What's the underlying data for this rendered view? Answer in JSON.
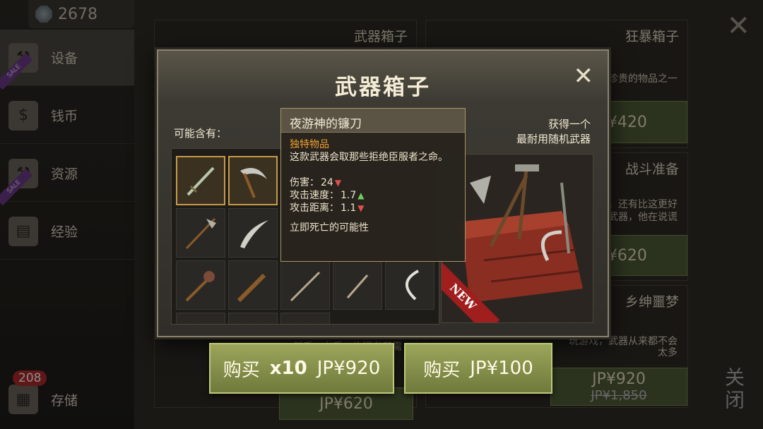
{
  "header": {
    "gem_count": "2678"
  },
  "sidebar": {
    "items": [
      {
        "label": "设备",
        "sale": "SALE"
      },
      {
        "label": "钱币"
      },
      {
        "label": "资源",
        "sale": "SALE"
      },
      {
        "label": "经验"
      }
    ],
    "storage": {
      "label": "存储",
      "badge": "208"
    }
  },
  "background_cards": {
    "weapon_box_title": "武器箱子",
    "rage_box_title": "狂暴箱子",
    "rage_box_desc": "珍贵的物品之一",
    "rage_box_price": "JP¥420",
    "battle_prep_title": "战斗准备",
    "battle_prep_desc1": "，还有比这更好",
    "battle_prep_desc2": "武器，他在说谎",
    "battle_prep_price": "JP¥620",
    "squire_title": "乡绅噩梦",
    "squire_desc1": "玩游戏，武器从来都不会",
    "squire_desc2": "太多",
    "squire_price": "JP¥920",
    "squire_old_price": "JP¥1,850",
    "left_card_desc": "新手，老手，旅行者所需",
    "left_card_price": "JP¥620",
    "close_label": "关闭"
  },
  "modal": {
    "title": "武器箱子",
    "may_contain": "可能含有：",
    "gain_line1": "获得一个",
    "gain_line2": "最耐用随机武器",
    "new_badge": "NEW"
  },
  "tooltip": {
    "name": "夜游神的镰刀",
    "rarity": "独特物品",
    "desc": "这款武器会取那些拒绝臣服者之命。",
    "damage_label": "伤害：",
    "damage_value": "24",
    "speed_label": "攻击速度：",
    "speed_value": "1.7",
    "range_label": "攻击距离：",
    "range_value": "1.1",
    "perk": "立即死亡的可能性"
  },
  "buttons": {
    "buy10_label": "购买",
    "buy10_qty": "x10",
    "buy10_price": "JP¥920",
    "buy1_label": "购买",
    "buy1_price": "JP¥100"
  }
}
